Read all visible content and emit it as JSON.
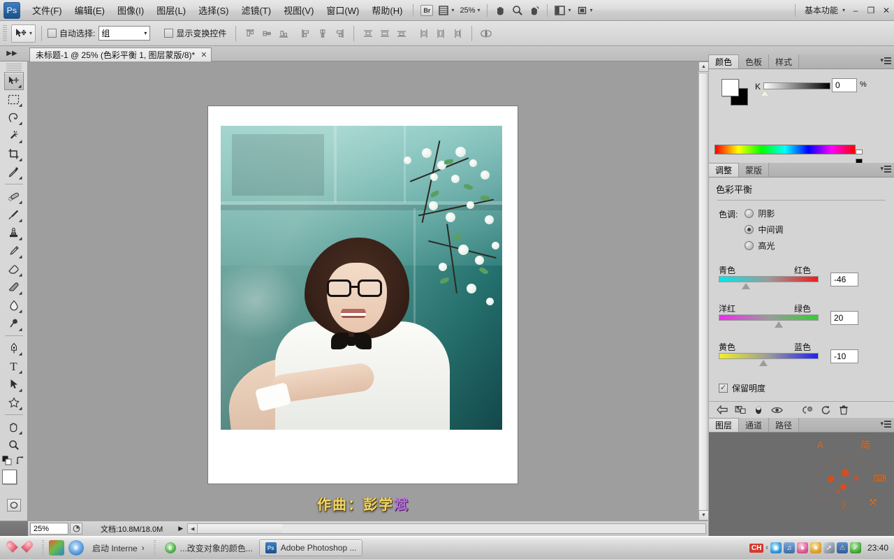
{
  "app": {
    "logo": "Ps",
    "title": "Adobe Photoshop"
  },
  "menubar": {
    "items": [
      {
        "label": "文件(F)"
      },
      {
        "label": "编辑(E)"
      },
      {
        "label": "图像(I)"
      },
      {
        "label": "图层(L)"
      },
      {
        "label": "选择(S)"
      },
      {
        "label": "滤镜(T)"
      },
      {
        "label": "视图(V)"
      },
      {
        "label": "窗口(W)"
      },
      {
        "label": "帮助(H)"
      }
    ],
    "bridge_label": "Br",
    "zoom_level": "25%",
    "workspace": "基本功能",
    "icons": {
      "view_extras": "view-extras-icon",
      "hand": "hand-icon",
      "zoom": "zoom-icon",
      "rotate_view": "rotate-view-icon",
      "screen_mode": "screen-mode-icon",
      "arrange": "arrange-documents-icon"
    },
    "window_buttons": {
      "minimize": "–",
      "restore": "❐",
      "close": "✕"
    }
  },
  "optionsbar": {
    "tool": "move-tool",
    "auto_select_label": "自动选择:",
    "auto_select_value": "组",
    "auto_select_checked": false,
    "show_transform_label": "显示变换控件",
    "show_transform_checked": false,
    "align_buttons": [
      "align-top-edges",
      "align-vertical-centers",
      "align-bottom-edges",
      "align-left-edges",
      "align-horizontal-centers",
      "align-right-edges",
      "distribute-top-edges",
      "distribute-vertical-centers",
      "distribute-bottom-edges",
      "distribute-left-edges",
      "distribute-horizontal-centers",
      "distribute-right-edges",
      "auto-align-layers"
    ]
  },
  "document": {
    "tab_title": "未标题-1 @ 25% (色彩平衡 1, 图层蒙版/8)*",
    "close_glyph": "✕"
  },
  "toolbar": {
    "tools": [
      {
        "name": "move-tool",
        "glyph": "✤",
        "selected": true
      },
      {
        "name": "rectangular-marquee-tool",
        "glyph": "⬚",
        "selected": false
      },
      {
        "name": "lasso-tool",
        "glyph": "☂",
        "selected": false
      },
      {
        "name": "magic-wand-tool",
        "glyph": "✦",
        "selected": false
      },
      {
        "name": "crop-tool",
        "glyph": "⌗",
        "selected": false
      },
      {
        "name": "eyedropper-tool",
        "glyph": "✒",
        "selected": false
      },
      {
        "name": "healing-brush-tool",
        "glyph": "✎",
        "selected": false
      },
      {
        "name": "brush-tool",
        "glyph": "✐",
        "selected": false
      },
      {
        "name": "clone-stamp-tool",
        "glyph": "⚑",
        "selected": false
      },
      {
        "name": "history-brush-tool",
        "glyph": "✑",
        "selected": false
      },
      {
        "name": "eraser-tool",
        "glyph": "▱",
        "selected": false
      },
      {
        "name": "gradient-tool",
        "glyph": "◨",
        "selected": false
      },
      {
        "name": "blur-tool",
        "glyph": "●",
        "selected": false
      },
      {
        "name": "dodge-tool",
        "glyph": "⚲",
        "selected": false
      },
      {
        "name": "pen-tool",
        "glyph": "✑",
        "selected": false
      },
      {
        "name": "type-tool",
        "glyph": "T",
        "selected": false
      },
      {
        "name": "path-selection-tool",
        "glyph": "➤",
        "selected": false
      },
      {
        "name": "custom-shape-tool",
        "glyph": "★",
        "selected": false
      },
      {
        "name": "hand-tool",
        "glyph": "✋",
        "selected": false
      },
      {
        "name": "zoom-tool",
        "glyph": "⌕",
        "selected": false
      }
    ],
    "foreground_color": "#ffffff",
    "background_color": "#000000",
    "quick_mask": "quick-mask-mode"
  },
  "canvas": {
    "caption_prefix": "作曲：彭学",
    "caption_suffix": "斌",
    "dots": "••• •••",
    "background_color": "#9e9e9e"
  },
  "statusbar": {
    "zoom_value": "25%",
    "doc_label": "文档:10.8M/18.0M",
    "arrow_glyph": "▶"
  },
  "panels": {
    "color": {
      "tabs": [
        {
          "label": "颜色",
          "active": true
        },
        {
          "label": "色板",
          "active": false
        },
        {
          "label": "样式",
          "active": false
        }
      ],
      "channel_label": "K",
      "channel_value": "0",
      "percent_label": "%",
      "foreground": "#ffffff",
      "background": "#000000"
    },
    "adjustments": {
      "tabs": [
        {
          "label": "调整",
          "active": true
        },
        {
          "label": "蒙版",
          "active": false
        }
      ],
      "title": "色彩平衡",
      "tone_label": "色调:",
      "tone_options": [
        {
          "label": "阴影",
          "selected": false
        },
        {
          "label": "中间调",
          "selected": true
        },
        {
          "label": "高光",
          "selected": false
        }
      ],
      "sliders": [
        {
          "left_label": "青色",
          "right_label": "红色",
          "value": "-46",
          "thumb_pct": 27
        },
        {
          "left_label": "洋红",
          "right_label": "绿色",
          "value": "20",
          "thumb_pct": 60
        },
        {
          "left_label": "黄色",
          "right_label": "蓝色",
          "value": "-10",
          "thumb_pct": 43
        }
      ],
      "preserve_label": "保留明度",
      "preserve_checked": true,
      "footer_icons": [
        "return-to-adjustment-list-icon",
        "clip-to-layer-icon",
        "toggle-layer-visibility-icon",
        "preview-eye-icon",
        "reset-previous-state-icon",
        "reset-adjustment-icon",
        "delete-adjustment-icon"
      ]
    },
    "layers": {
      "tabs": [
        {
          "label": "图层",
          "active": true
        },
        {
          "label": "通道",
          "active": false
        },
        {
          "label": "路径",
          "active": false
        }
      ]
    },
    "ime_overlay": {
      "glyph_a": "A",
      "glyph_jian": "简",
      "glyph_moon": "☽",
      "glyph_keyboard": "⌨",
      "glyph_tool": "⚒"
    }
  },
  "taskbar": {
    "start": "start-button",
    "quick_launch": [
      {
        "name": "quicklaunch-photoshop",
        "glyph": ""
      },
      {
        "name": "quicklaunch-internet-explorer",
        "glyph": "e"
      }
    ],
    "items": [
      {
        "name": "taskbar-launch-internet",
        "label": "启动 Interne",
        "chevron": "›",
        "icon": "ie-icon",
        "active": false
      },
      {
        "name": "taskbar-browser-window",
        "label": "...改变对象的颜色...",
        "icon": "browser-icon",
        "active": false
      },
      {
        "name": "taskbar-photoshop",
        "label": "Adobe Photoshop ...",
        "icon": "ps-icon",
        "active": true
      }
    ],
    "tray": {
      "ime": "CH",
      "chevron": "‹",
      "icons": [
        "qq-icon",
        "volume-icon",
        "penguin-icon",
        "shield-green-icon",
        "rocket-icon",
        "warning-icon",
        "security-icon"
      ],
      "time": "23:40"
    }
  },
  "colors": {
    "panel_bg": "#d4d4d4",
    "canvas_bg": "#9e9e9e",
    "accent": "#2a5d96"
  }
}
